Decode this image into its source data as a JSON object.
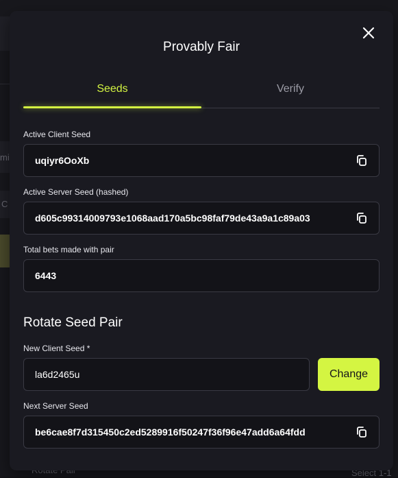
{
  "modal": {
    "title": "Provably Fair",
    "tabs": [
      {
        "label": "Seeds",
        "active": true
      },
      {
        "label": "Verify",
        "active": false
      }
    ],
    "active_client_seed": {
      "label": "Active Client Seed",
      "value": "uqiyr6OoXb"
    },
    "active_server_seed": {
      "label": "Active Server Seed (hashed)",
      "value": "d605c99314009793e1068aad170a5bc98faf79de43a9a1c89a03"
    },
    "total_bets": {
      "label": "Total bets made with pair",
      "value": "6443"
    },
    "rotate": {
      "title": "Rotate Seed Pair",
      "new_client_seed": {
        "label": "New Client Seed *",
        "value": "la6d2465u"
      },
      "change_label": "Change",
      "next_server_seed": {
        "label": "Next Server Seed",
        "value": "be6cae8f7d315450c2ed5289916f50247f36f96e47add6a64fdd"
      }
    }
  },
  "background": {
    "text_mi": "mi",
    "text_c": "C",
    "text_bottom_left": "Rotate Pair",
    "text_bottom_right": "Select 1-1"
  },
  "colors": {
    "accent": "#d4f542",
    "modal_bg": "#1a1a21",
    "field_bg": "#131318"
  }
}
